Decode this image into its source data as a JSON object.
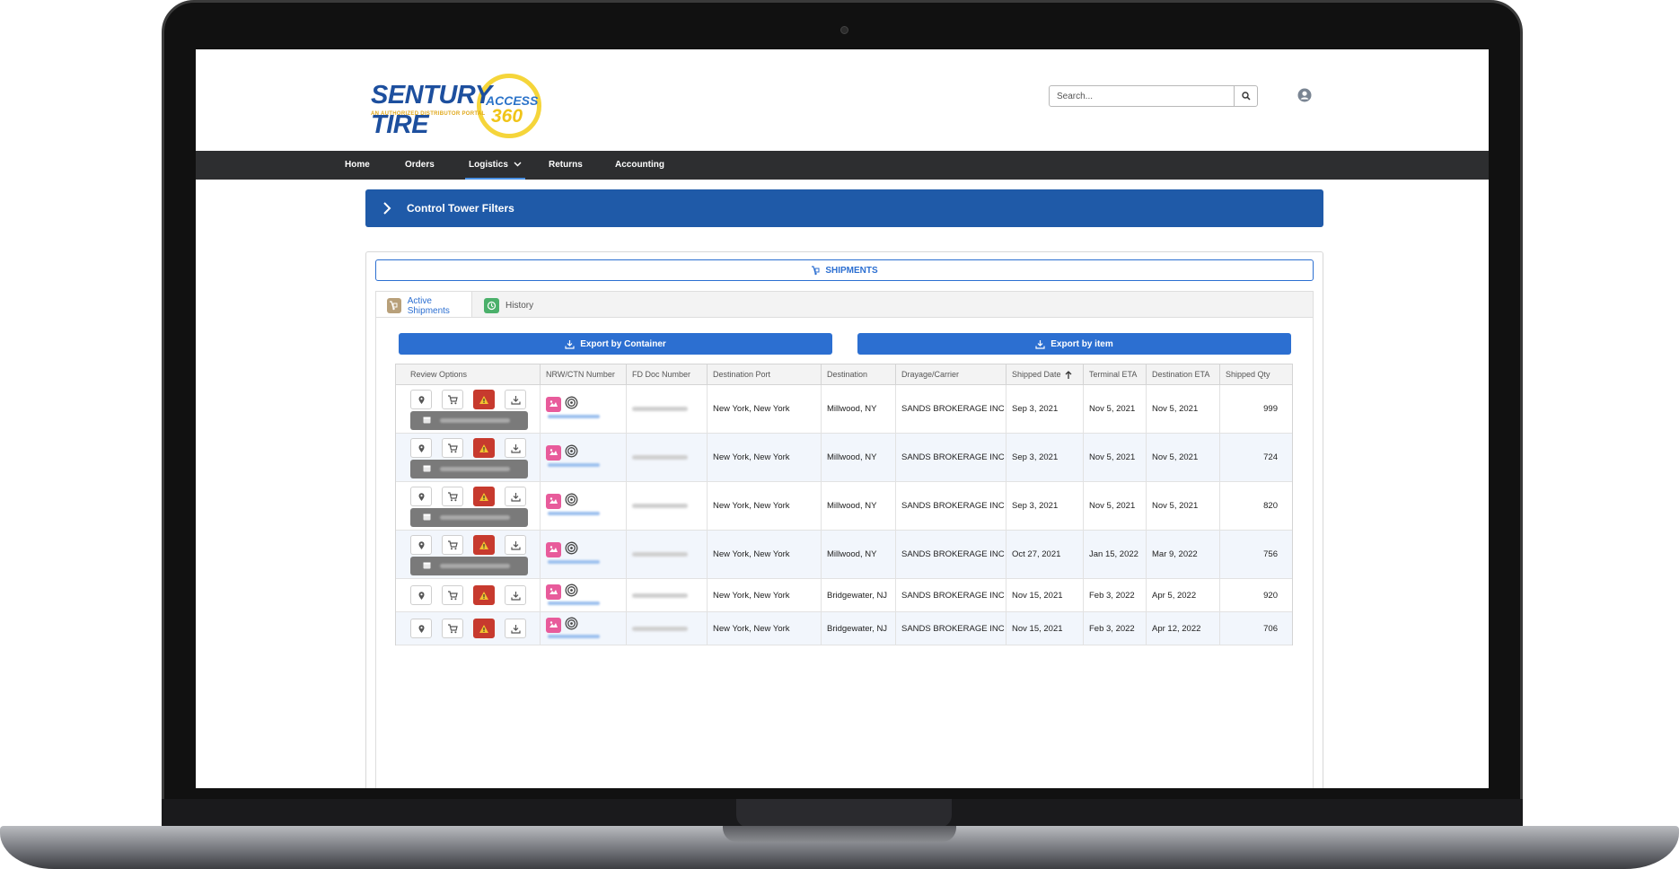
{
  "header": {
    "logo": {
      "main": "SENTURY TIRE",
      "tagline": "AN AUTHORIZED DISTRIBUTOR PORTAL",
      "access": "ACCESS",
      "number": "360"
    },
    "search": {
      "placeholder": "Search..."
    },
    "icons": {
      "search": "search-icon",
      "user": "user-icon"
    }
  },
  "nav": {
    "items": [
      {
        "label": "Home"
      },
      {
        "label": "Orders"
      },
      {
        "label": "Logistics",
        "active": true
      },
      {
        "label": "Returns"
      },
      {
        "label": "Accounting"
      }
    ]
  },
  "control_tower": {
    "label": "Control Tower Filters"
  },
  "shipments": {
    "button_label": "SHIPMENTS",
    "tabs": [
      {
        "label": "Active Shipments",
        "active": true
      },
      {
        "label": "History"
      }
    ],
    "export_container_label": "Export by Container",
    "export_item_label": "Export by item"
  },
  "table": {
    "columns": [
      "Review Options",
      "NRW/CTN Number",
      "FD Doc Number",
      "Destination Port",
      "Destination",
      "Drayage/Carrier",
      "Shipped Date",
      "Terminal ETA",
      "Destination ETA",
      "Shipped Qty"
    ],
    "sort_column": "Shipped Date",
    "rows": [
      {
        "port": "New York, New York",
        "destination": "Millwood, NY",
        "carrier": "SANDS BROKERAGE INC",
        "shipped": "Sep 3, 2021",
        "terminal_eta": "Nov 5, 2021",
        "dest_eta": "Nov 5, 2021",
        "qty": "999",
        "has_date_pill": true
      },
      {
        "port": "New York, New York",
        "destination": "Millwood, NY",
        "carrier": "SANDS BROKERAGE INC",
        "shipped": "Sep 3, 2021",
        "terminal_eta": "Nov 5, 2021",
        "dest_eta": "Nov 5, 2021",
        "qty": "724",
        "has_date_pill": true
      },
      {
        "port": "New York, New York",
        "destination": "Millwood, NY",
        "carrier": "SANDS BROKERAGE INC",
        "shipped": "Sep 3, 2021",
        "terminal_eta": "Nov 5, 2021",
        "dest_eta": "Nov 5, 2021",
        "qty": "820",
        "has_date_pill": true
      },
      {
        "port": "New York, New York",
        "destination": "Millwood, NY",
        "carrier": "SANDS BROKERAGE INC",
        "shipped": "Oct 27, 2021",
        "terminal_eta": "Jan 15, 2022",
        "dest_eta": "Mar 9, 2022",
        "qty": "756",
        "has_date_pill": true
      },
      {
        "port": "New York, New York",
        "destination": "Bridgewater, NJ",
        "carrier": "SANDS BROKERAGE INC",
        "shipped": "Nov 15, 2021",
        "terminal_eta": "Feb 3, 2022",
        "dest_eta": "Apr 5, 2022",
        "qty": "920",
        "has_date_pill": false
      },
      {
        "port": "New York, New York",
        "destination": "Bridgewater, NJ",
        "carrier": "SANDS BROKERAGE INC",
        "shipped": "Nov 15, 2021",
        "terminal_eta": "Feb 3, 2022",
        "dest_eta": "Apr 12, 2022",
        "qty": "706",
        "has_date_pill": false
      }
    ]
  },
  "colors": {
    "brand_blue": "#1f5aa8",
    "accent_blue": "#2c6fd1",
    "nav_bg": "#2d2e30",
    "warning_red": "#c73a2e",
    "tag_pink": "#e85b9b"
  }
}
